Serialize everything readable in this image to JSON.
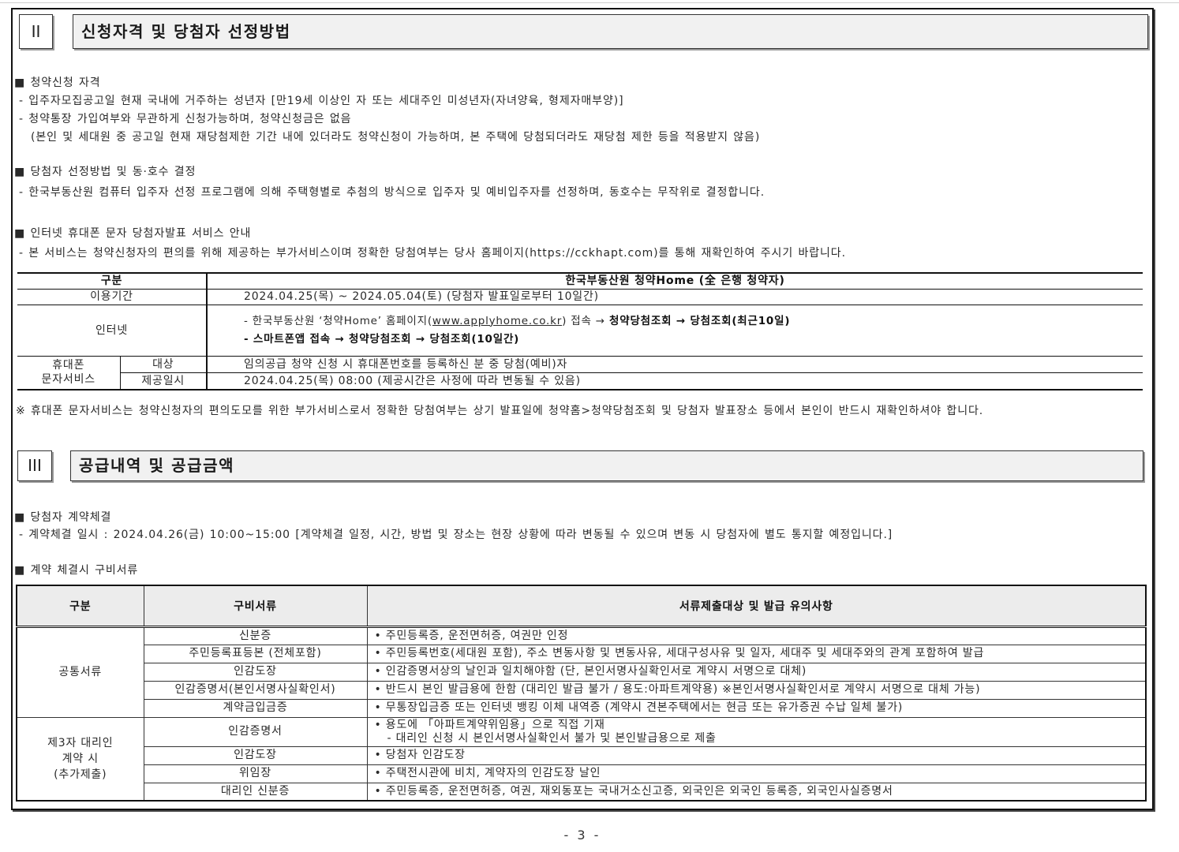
{
  "section2": {
    "number": "II",
    "title": "신청자격 및 당첨자 선정방법",
    "eligibility": {
      "heading": "■ 청약신청 자격",
      "lines": [
        "- 입주자모집공고일 현재 국내에 거주하는 성년자 [만19세 이상인 자 또는 세대주인 미성년자(자녀양육, 형제자매부양)]",
        "- 청약통장 가입여부와 무관하게 신청가능하며, 청약신청금은 없음",
        "(본인 및 세대원 중 공고일 현재 재당첨제한 기간 내에 있더라도 청약신청이 가능하며, 본 주택에 당첨되더라도 재당첨 제한 등을 적용받지 않음)"
      ]
    },
    "selection": {
      "heading": "■ 당첨자 선정방법 및 동·호수 결정",
      "lines": [
        "- 한국부동산원 컴퓨터 입주자 선정 프로그램에 의해 주택형별로 추첨의 방식으로 입주자 및 예비입주자를 선정하며, 동호수는 무작위로 결정합니다."
      ]
    },
    "announcement_service": {
      "heading": "■ 인터넷 휴대폰 문자 당첨자발표 서비스 안내",
      "lines": [
        "- 본 서비스는 청약신청자의 편의를 위해 제공하는 부가서비스이며 정확한 당첨여부는 당사 홈페이지(https://cckhapt.com)를 통해 재확인하여 주시기 바랍니다."
      ]
    },
    "service_table": {
      "header": {
        "category": "구분",
        "provider": "한국부동산원 청약Home (全 은행 청약자)"
      },
      "period": {
        "label": "이용기간",
        "value": "2024.04.25(목) ~ 2024.05.04(토) (당첨자 발표일로부터 10일간)"
      },
      "internet": {
        "label": "인터넷",
        "web_prefix": "- 한국부동산원 ‘청약Home’ 홈페이지(",
        "web_link": "www.applyhome.co.kr",
        "web_middle": ") 접속 → ",
        "web_path": "청약당첨조회 → 당첨조회(최근10일)",
        "app_line": "- 스마트폰앱 접속  → 청약당첨조회 → 당첨조회(10일간)"
      },
      "sms": {
        "label_lines": [
          "휴대폰",
          "문자서비스"
        ],
        "target_label": "대상",
        "target_value": "임의공급 청약 신청 시 휴대폰번호를 등록하신 분 중 당첨(예비)자",
        "time_label": "제공일시",
        "time_value": "2024.04.25(목) 08:00 (제공시간은 사정에 따라 변동될 수 있음)"
      }
    },
    "note": "※ 휴대폰 문자서비스는 청약신청자의 편의도모를 위한 부가서비스로서 정확한 당첨여부는 상기 발표일에 청약홈>청약당첨조회 및 당첨자 발표장소 등에서 본인이 반드시 재확인하셔야 합니다."
  },
  "section3": {
    "number": "III",
    "title": "공급내역 및 공급금액",
    "contract": {
      "heading": "■ 당첨자 계약체결",
      "lines": [
        "- 계약체결 일시 : 2024.04.26(금) 10:00~15:00 [계약체결 일정, 시간, 방법 및 장소는 현장 상황에 따라 변동될 수 있으며 변동 시 당첨자에 별도 통지할 예정입니다.]"
      ]
    },
    "documents_heading": "■ 계약 체결시 구비서류",
    "documents_table": {
      "headers": [
        "구분",
        "구비서류",
        "서류제출대상 및 발급 유의사항"
      ],
      "groups": [
        {
          "category_lines": [
            "공통서류"
          ],
          "rows": [
            {
              "doc": "신분증",
              "notes": [
                "• 주민등록증, 운전면허증, 여권만 인정"
              ]
            },
            {
              "doc": "주민등록표등본 (전체포함)",
              "notes": [
                "• 주민등록번호(세대원 포함), 주소 변동사항 및 변동사유, 세대구성사유 및 일자, 세대주 및 세대주와의 관계 포함하여 발급"
              ]
            },
            {
              "doc": "인감도장",
              "notes": [
                "• 인감증명서상의 날인과 일치해야함 (단, 본인서명사실확인서로 계약시 서명으로 대체)"
              ]
            },
            {
              "doc": "인감증명서(본인서명사실확인서)",
              "notes": [
                "• 반드시 본인 발급용에 한함 (대리인 발급 불가 / 용도:아파트계약용) ※본인서명사실확인서로 계약시 서명으로 대체 가능)"
              ]
            },
            {
              "doc": "계약금입금증",
              "notes": [
                "• 무통장입금증 또는 인터넷 뱅킹 이체 내역증 (계약시 견본주택에서는 현금 또는 유가증권 수납 일체 불가)"
              ]
            }
          ]
        },
        {
          "category_lines": [
            "제3자 대리인",
            "계약 시",
            "(추가제출)"
          ],
          "rows": [
            {
              "doc": "인감증명서",
              "notes": [
                "• 용도에 「아파트계약위임용」으로 직접 기재",
                "- 대리인 신청 시 본인서명사실확인서 불가 및 본인발급용으로 제출"
              ]
            },
            {
              "doc": "인감도장",
              "notes": [
                "• 당첨자 인감도장"
              ]
            },
            {
              "doc": "위임장",
              "notes": [
                "• 주택전시관에 비치, 계약자의 인감도장 날인"
              ]
            },
            {
              "doc": "대리인 신분증",
              "notes": [
                "• 주민등록증, 운전면허증, 여권, 재외동포는 국내거소신고증, 외국인은 외국인 등록증, 외국인사실증명서"
              ]
            }
          ]
        }
      ]
    }
  },
  "page_number": "- 3 -"
}
